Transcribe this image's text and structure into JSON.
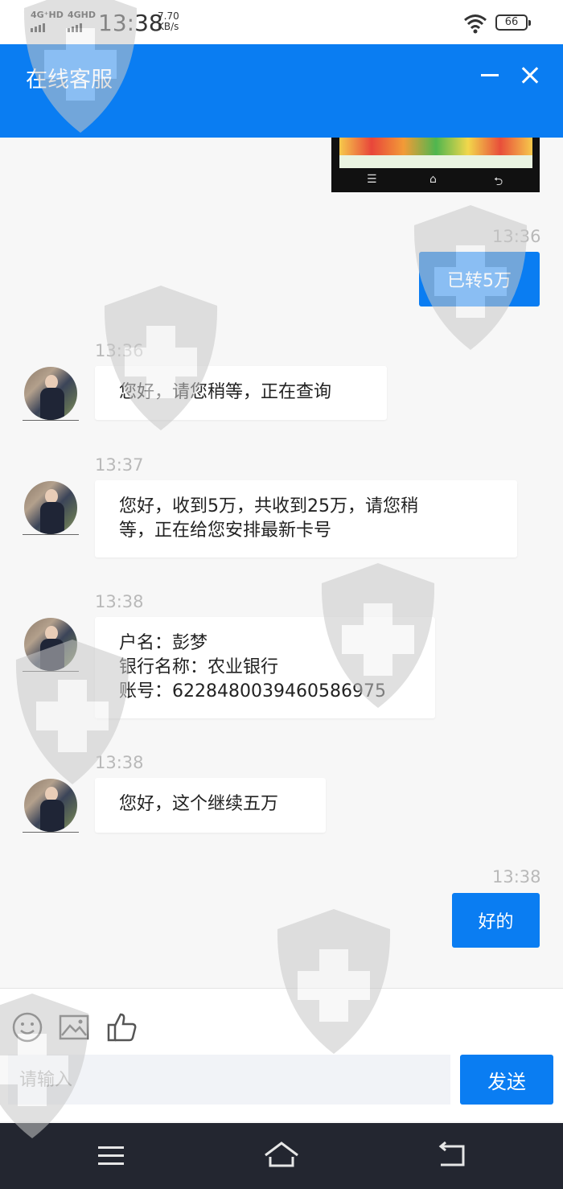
{
  "status_bar": {
    "network1": "4G⁺HD",
    "network2": "4GHD",
    "time": "13:38",
    "speed_value": "7.70",
    "speed_unit": "KB/s",
    "battery": "66"
  },
  "header": {
    "title": "在线客服",
    "minimize_icon": "minimize-icon",
    "close_icon": "close-icon"
  },
  "messages": [
    {
      "side": "out",
      "time": "13:36",
      "text": "已转5万"
    },
    {
      "side": "in",
      "time": "13:36",
      "lines": [
        "您好，请您稍等，正在查询"
      ]
    },
    {
      "side": "in",
      "time": "13:37",
      "lines": [
        "您好，收到5万，共收到25万，请您稍",
        "等，正在给您安排最新卡号"
      ]
    },
    {
      "side": "in",
      "time": "13:38",
      "lines": [
        "户名：彭梦",
        "银行名称：农业银行",
        "账号：6228480039460586975"
      ]
    },
    {
      "side": "in",
      "time": "13:38",
      "lines": [
        "您好，这个继续五万"
      ]
    },
    {
      "side": "out",
      "time": "13:38",
      "text": "好的"
    }
  ],
  "composer": {
    "placeholder": "请输入",
    "send_label": "发送",
    "tools": [
      "emoji-icon",
      "image-icon",
      "thumbs-up-icon"
    ]
  },
  "colors": {
    "accent": "#0a7df2",
    "nav_bar": "#232630",
    "timestamp": "#b9b9b9"
  }
}
